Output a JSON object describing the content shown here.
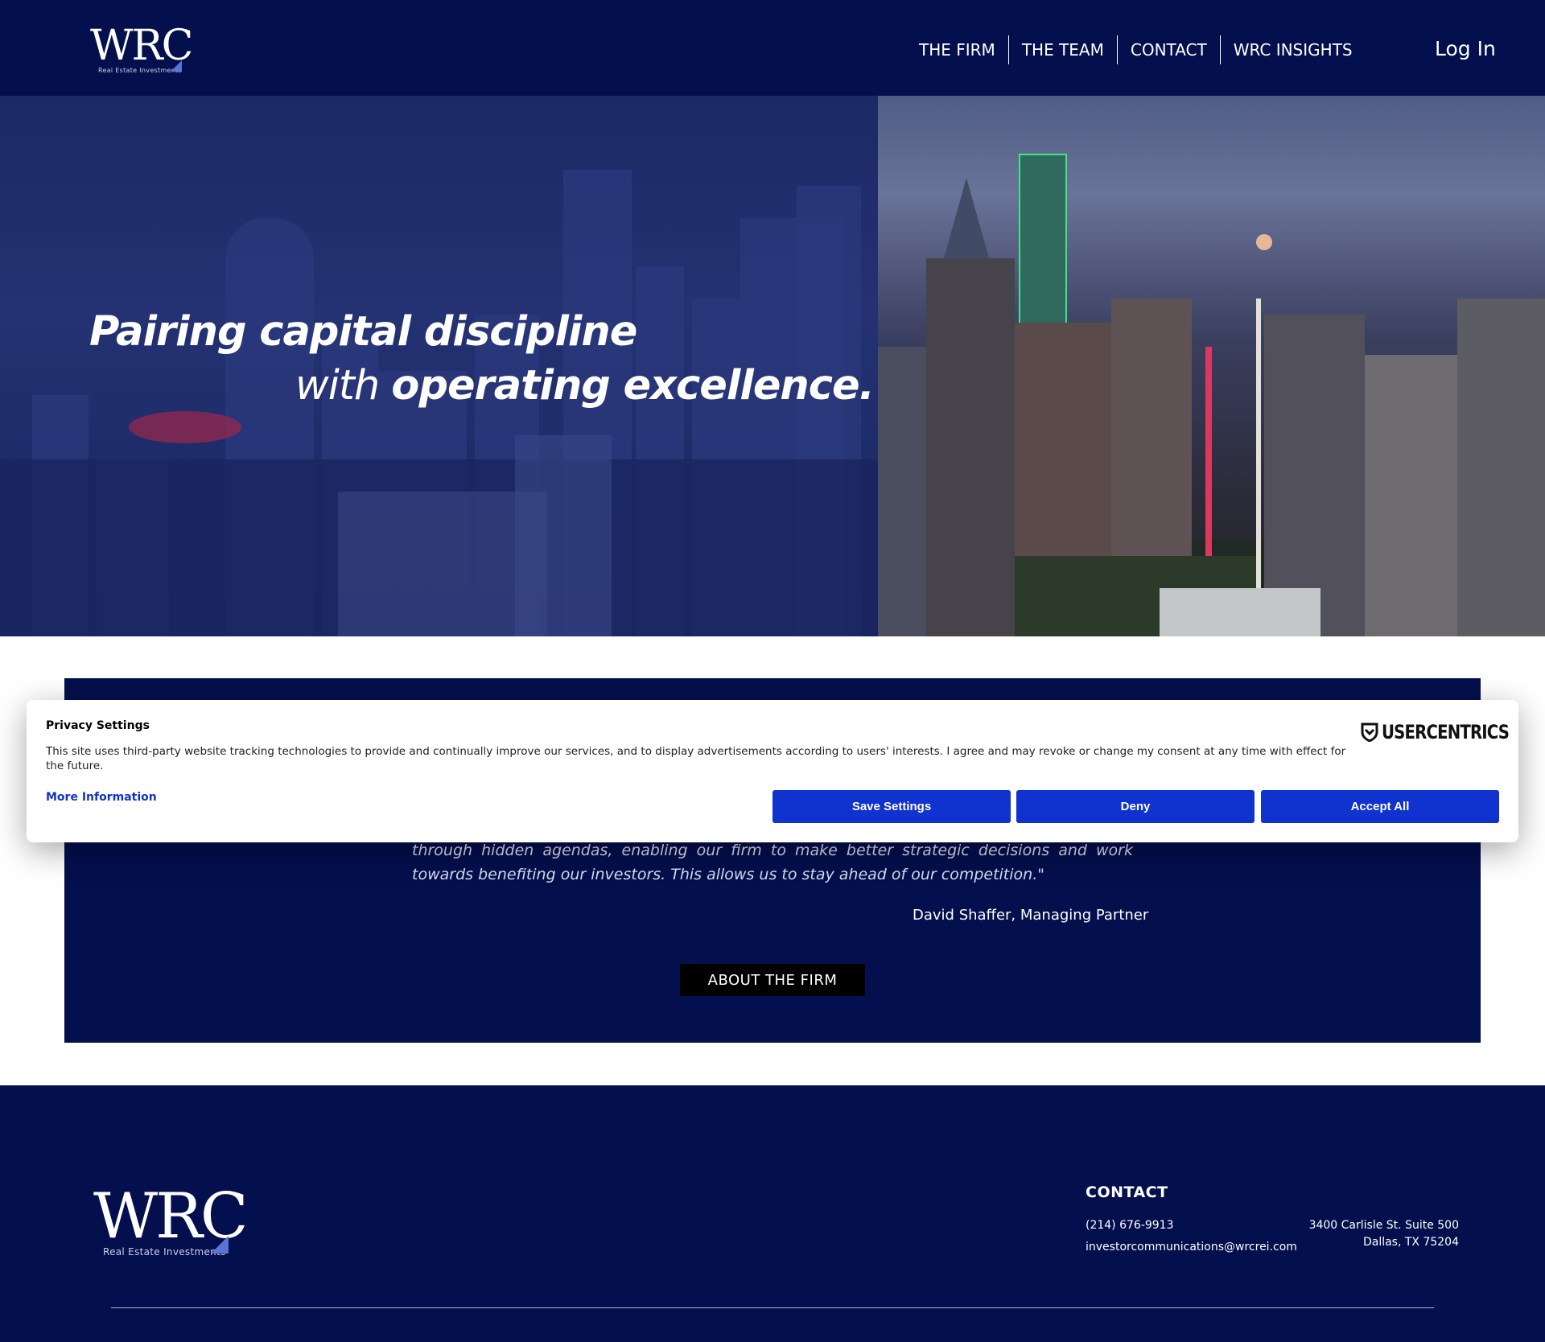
{
  "header": {
    "logo_text": "WRC",
    "logo_subtext": "Real Estate Investments",
    "nav": [
      {
        "label": "THE FIRM"
      },
      {
        "label": "THE TEAM"
      },
      {
        "label": "CONTACT"
      },
      {
        "label": "WRC INSIGHTS"
      }
    ],
    "login_label": "Log In"
  },
  "hero": {
    "line1": "Pairing capital discipline",
    "line2_light": "with",
    "line2_bold": "operating excellence."
  },
  "quote": {
    "text_visible": "through hidden agendas, enabling our firm to make better strategic decisions and work towards benefiting our investors. This allows us to stay ahead of our competition.\"",
    "author": "David Shaffer, Managing Partner",
    "button_label": "ABOUT THE FIRM"
  },
  "privacy": {
    "title": "Privacy Settings",
    "body": "This site uses third-party website tracking technologies to provide and continually improve our services, and to display advertisements according to users' interests. I agree and may revoke or change my consent at any time with effect for the future.",
    "more_info": "More Information",
    "brand": "USERCENTRICS",
    "buttons": {
      "save": "Save Settings",
      "deny": "Deny",
      "accept": "Accept All"
    },
    "accent_color": "#1032cf"
  },
  "footer": {
    "logo_text": "WRC",
    "logo_subtext": "Real Estate Investments",
    "contact_title": "CONTACT",
    "phone": "(214) 676-9913",
    "email": "investorcommunications@wrcrei.com",
    "address_line1": "3400 Carlisle St. Suite 500",
    "address_line2": "Dallas, TX 75204"
  },
  "colors": {
    "navy": "#040f4d",
    "button_blue": "#1032cf"
  }
}
